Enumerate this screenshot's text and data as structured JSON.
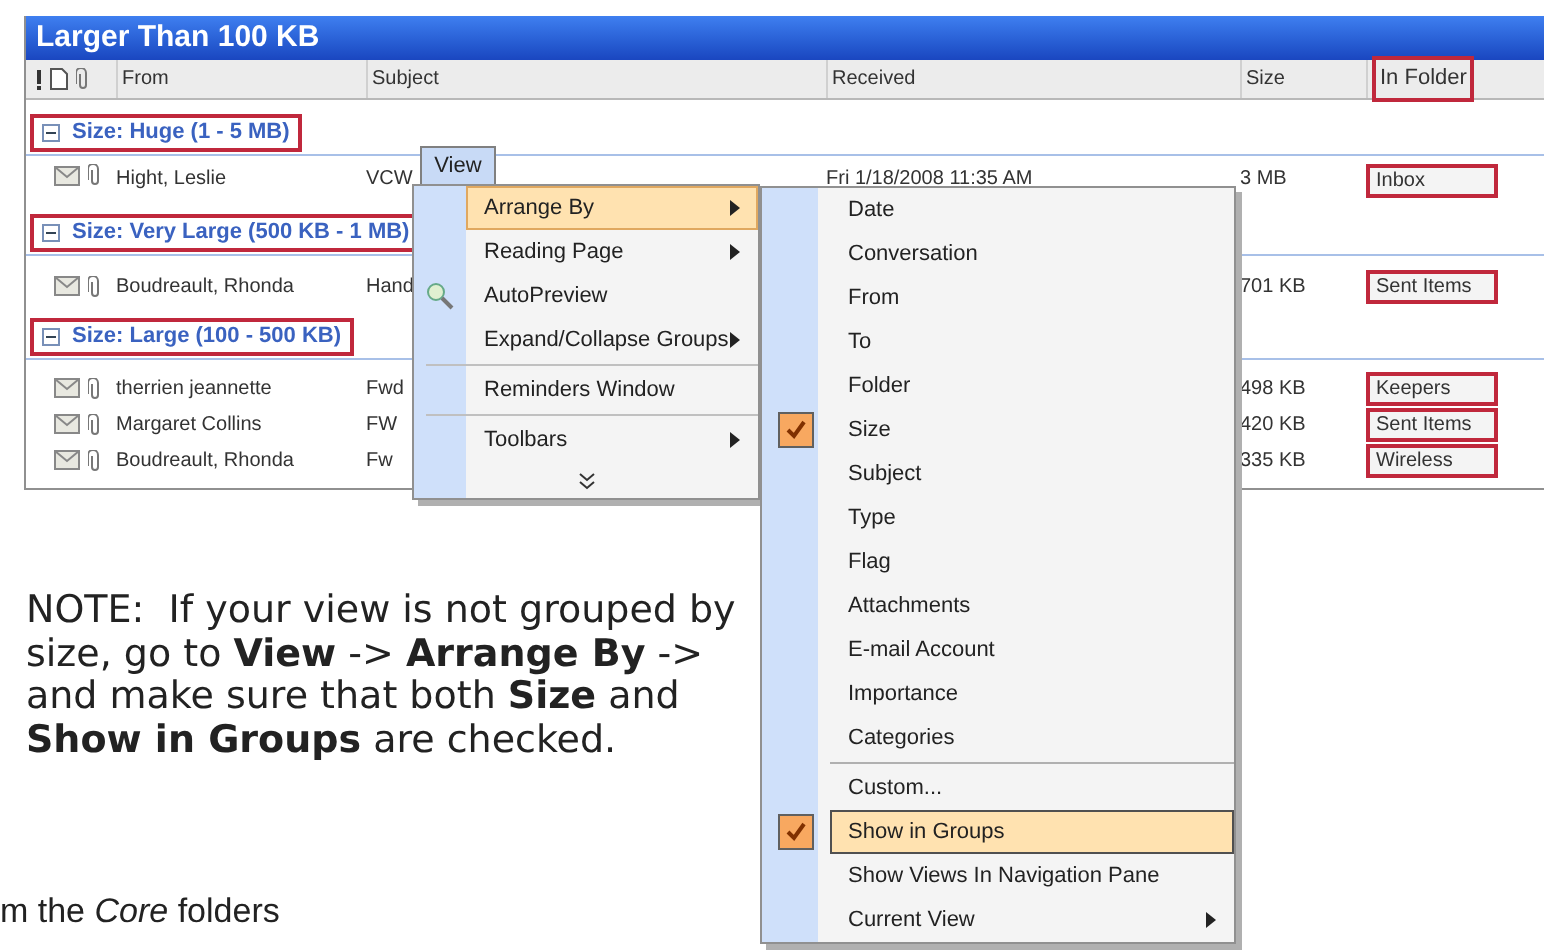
{
  "window": {
    "title": "Larger Than 100 KB"
  },
  "columns": [
    {
      "label": "From",
      "annotated": false
    },
    {
      "label": "Subject",
      "annotated": false
    },
    {
      "label": "Received",
      "annotated": false
    },
    {
      "label": "Size",
      "annotated": false
    },
    {
      "label": "In Folder",
      "annotated": true
    }
  ],
  "groups": [
    {
      "label": "Size: Huge (1 - 5 MB)",
      "annotated": true,
      "rows": [
        {
          "from": "Hight, Leslie",
          "subject": "VCW",
          "received": "Fri 1/18/2008 11:35 AM",
          "size": "3 MB",
          "folder": "Inbox",
          "annotated": true
        }
      ]
    },
    {
      "label": "Size: Very Large (500 KB - 1 MB)",
      "annotated": true,
      "rows": [
        {
          "from": "Boudreault, Rhonda",
          "subject": "Hand",
          "size": "701 KB",
          "folder": "Sent Items",
          "annotated": true
        }
      ]
    },
    {
      "label": "Size: Large (100 - 500 KB)",
      "annotated": true,
      "rows": [
        {
          "from": "therrien jeannette",
          "subject": "Fwd",
          "size": "498 KB",
          "folder": "Keepers",
          "annotated": true
        },
        {
          "from": "Margaret Collins",
          "subject": "FW",
          "size": "420 KB",
          "folder": "Sent Items",
          "annotated": true
        },
        {
          "from": "Boudreault, Rhonda",
          "subject": "Fw",
          "size": "335 KB",
          "folder": "Wireless",
          "annotated": true
        }
      ]
    }
  ],
  "view_menu": {
    "title": "View",
    "items": [
      {
        "kind": "item",
        "label": "Arrange By",
        "submenu": true,
        "highlighted": true,
        "icon": false
      },
      {
        "kind": "item",
        "label": "Reading Page",
        "submenu": true,
        "highlighted": false,
        "icon": false
      },
      {
        "kind": "item",
        "label": "AutoPreview",
        "submenu": false,
        "highlighted": false,
        "icon": true
      },
      {
        "kind": "item",
        "label": "Expand/Collapse Groups",
        "submenu": true,
        "highlighted": false,
        "icon": false
      },
      {
        "kind": "separator"
      },
      {
        "kind": "item",
        "label": "Reminders Window",
        "submenu": false,
        "highlighted": false,
        "icon": false
      },
      {
        "kind": "separator"
      },
      {
        "kind": "item",
        "label": "Toolbars",
        "submenu": true,
        "highlighted": false,
        "icon": false
      },
      {
        "kind": "more"
      }
    ]
  },
  "arrange_menu": {
    "items": [
      {
        "kind": "item",
        "label": "Date",
        "checked": false,
        "highlighted": false,
        "submenu": false
      },
      {
        "kind": "item",
        "label": "Conversation",
        "checked": false,
        "highlighted": false,
        "submenu": false
      },
      {
        "kind": "item",
        "label": "From",
        "checked": false,
        "highlighted": false,
        "submenu": false
      },
      {
        "kind": "item",
        "label": "To",
        "checked": false,
        "highlighted": false,
        "submenu": false
      },
      {
        "kind": "item",
        "label": "Folder",
        "checked": false,
        "highlighted": false,
        "submenu": false
      },
      {
        "kind": "item",
        "label": "Size",
        "checked": true,
        "highlighted": false,
        "submenu": false
      },
      {
        "kind": "item",
        "label": "Subject",
        "checked": false,
        "highlighted": false,
        "submenu": false
      },
      {
        "kind": "item",
        "label": "Type",
        "checked": false,
        "highlighted": false,
        "submenu": false
      },
      {
        "kind": "item",
        "label": "Flag",
        "checked": false,
        "highlighted": false,
        "submenu": false
      },
      {
        "kind": "item",
        "label": "Attachments",
        "checked": false,
        "highlighted": false,
        "submenu": false
      },
      {
        "kind": "item",
        "label": "E-mail Account",
        "checked": false,
        "highlighted": false,
        "submenu": false
      },
      {
        "kind": "item",
        "label": "Importance",
        "checked": false,
        "highlighted": false,
        "submenu": false
      },
      {
        "kind": "item",
        "label": "Categories",
        "checked": false,
        "highlighted": false,
        "submenu": false
      },
      {
        "kind": "separator"
      },
      {
        "kind": "item",
        "label": "Custom...",
        "checked": false,
        "highlighted": false,
        "submenu": false
      },
      {
        "kind": "item",
        "label": "Show in Groups",
        "checked": true,
        "highlighted": true,
        "submenu": false
      },
      {
        "kind": "item",
        "label": "Show Views In Navigation Pane",
        "checked": false,
        "highlighted": false,
        "submenu": false
      },
      {
        "kind": "item",
        "label": "Current View",
        "checked": false,
        "highlighted": false,
        "submenu": true
      }
    ]
  },
  "note": "NOTE:  If your view is not grouped by size, go to **View** -> **Arrange By** -> and make sure that both **Size** and **Show in Groups** are checked.",
  "caption": "m the *Core* folders"
}
